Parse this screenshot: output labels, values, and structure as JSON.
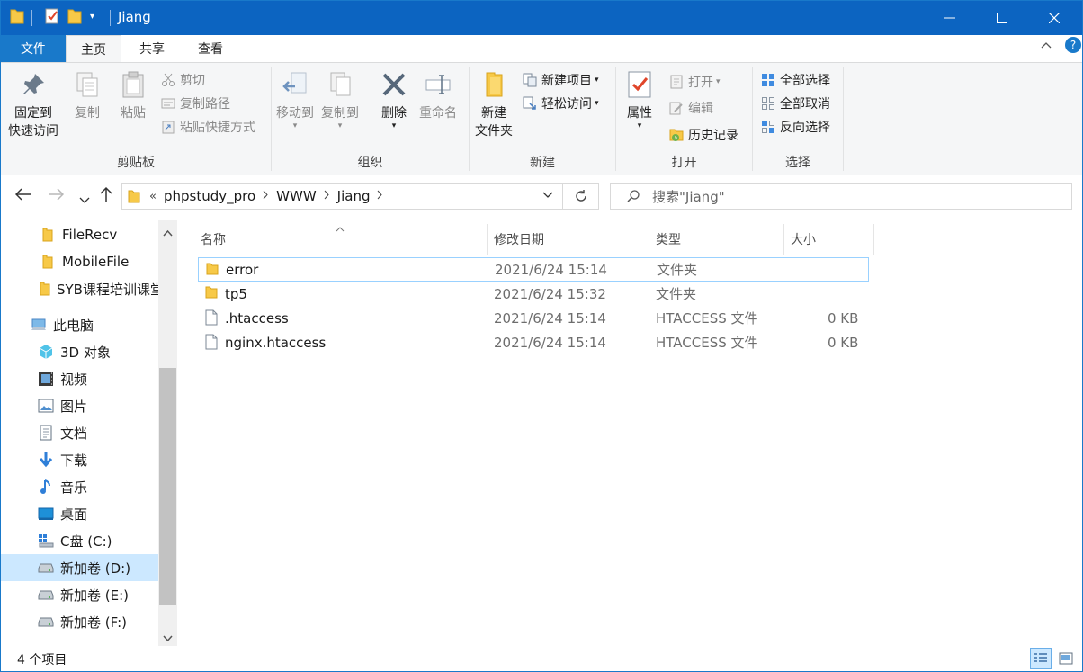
{
  "window": {
    "title": "Jiang",
    "controls": {
      "minimize": "—",
      "maximize": "☐",
      "close": "✕"
    }
  },
  "tabs": {
    "file": "文件",
    "home": "主页",
    "share": "共享",
    "view": "查看",
    "collapse_glyph": "^",
    "help_glyph": "?"
  },
  "ribbon": {
    "clipboard": {
      "label": "剪贴板",
      "pin_line1": "固定到",
      "pin_line2": "快速访问",
      "copy": "复制",
      "paste": "粘贴",
      "cut": "剪切",
      "copy_path": "复制路径",
      "paste_shortcut": "粘贴快捷方式"
    },
    "organize": {
      "label": "组织",
      "move_to": "移动到",
      "copy_to": "复制到",
      "delete": "删除",
      "rename": "重命名"
    },
    "new": {
      "label": "新建",
      "new_folder_line1": "新建",
      "new_folder_line2": "文件夹",
      "new_item": "新建项目",
      "easy_access": "轻松访问"
    },
    "open": {
      "label": "打开",
      "properties": "属性",
      "open": "打开",
      "edit": "编辑",
      "history": "历史记录"
    },
    "select": {
      "label": "选择",
      "select_all": "全部选择",
      "select_none": "全部取消",
      "invert": "反向选择"
    }
  },
  "address": {
    "overflow": "«",
    "crumbs": [
      "phpstudy_pro",
      "WWW",
      "Jiang"
    ],
    "search_placeholder": "搜索\"Jiang\""
  },
  "nav_pane": {
    "items": [
      {
        "label": "FileRecv",
        "icon": "folder-icon"
      },
      {
        "label": "MobileFile",
        "icon": "folder-icon"
      },
      {
        "label": "SYB课程培训课堂",
        "icon": "folder-icon"
      },
      {
        "label": "此电脑",
        "icon": "computer-icon"
      },
      {
        "label": "3D 对象",
        "icon": "3d-objects-icon"
      },
      {
        "label": "视频",
        "icon": "video-icon"
      },
      {
        "label": "图片",
        "icon": "pictures-icon"
      },
      {
        "label": "文档",
        "icon": "documents-icon"
      },
      {
        "label": "下载",
        "icon": "download-icon"
      },
      {
        "label": "音乐",
        "icon": "music-icon"
      },
      {
        "label": "桌面",
        "icon": "desktop-icon"
      },
      {
        "label": "C盘 (C:)",
        "icon": "system-drive-icon"
      },
      {
        "label": "新加卷 (D:)",
        "icon": "drive-icon"
      },
      {
        "label": "新加卷 (E:)",
        "icon": "drive-icon"
      },
      {
        "label": "新加卷 (F:)",
        "icon": "drive-icon"
      }
    ]
  },
  "file_list": {
    "columns": {
      "name": "名称",
      "modified": "修改日期",
      "type": "类型",
      "size": "大小"
    },
    "rows": [
      {
        "name": "error",
        "modified": "2021/6/24 15:14",
        "type": "文件夹",
        "size": "",
        "icon": "folder-icon"
      },
      {
        "name": "tp5",
        "modified": "2021/6/24 15:32",
        "type": "文件夹",
        "size": "",
        "icon": "folder-icon"
      },
      {
        "name": ".htaccess",
        "modified": "2021/6/24 15:14",
        "type": "HTACCESS 文件",
        "size": "0 KB",
        "icon": "file-icon"
      },
      {
        "name": "nginx.htaccess",
        "modified": "2021/6/24 15:14",
        "type": "HTACCESS 文件",
        "size": "0 KB",
        "icon": "file-icon"
      }
    ]
  },
  "status_bar": {
    "item_count": "4 个项目"
  },
  "colors": {
    "title_bar": "#0c64c1",
    "file_tab": "#1979ca",
    "ribbon_bg": "#f5f6f7",
    "folder_yellow": "#f7c948",
    "selection": "#cce8ff"
  }
}
